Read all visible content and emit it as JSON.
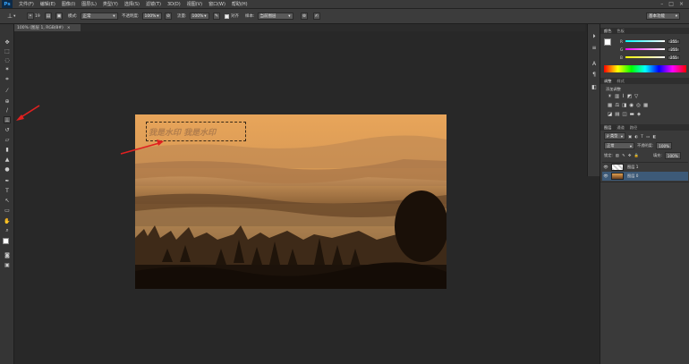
{
  "app": {
    "logo": "Ps"
  },
  "menu": [
    "文件(F)",
    "编辑(E)",
    "图像(I)",
    "图层(L)",
    "类型(Y)",
    "选择(S)",
    "滤镜(T)",
    "3D(D)",
    "视图(V)",
    "窗口(W)",
    "帮助(H)"
  ],
  "options": {
    "brush_size": "19",
    "mode_label": "模式:",
    "mode_value": "正常",
    "opacity_label": "不透明度:",
    "opacity_value": "100%",
    "flow_label": "流量:",
    "flow_value": "100%",
    "aligned_label": "对齐",
    "sample_label": "样本:",
    "sample_value": "当前图层",
    "workspace": "基本功能"
  },
  "document": {
    "tab_title": "100% (图层 1, RGB/8#)",
    "close": "×"
  },
  "watermark": {
    "text": "我是水印 我是水印"
  },
  "color_panel": {
    "tabs": [
      "颜色",
      "色板"
    ],
    "channels": [
      {
        "label": "R",
        "value": "255"
      },
      {
        "label": "G",
        "value": "255"
      },
      {
        "label": "B",
        "value": "255"
      }
    ]
  },
  "adjust_panel": {
    "tabs": [
      "调整",
      "样式"
    ],
    "title": "添加调整"
  },
  "layers_panel": {
    "tabs": [
      "图层",
      "通道",
      "路径"
    ],
    "kind_label": "ρ 类型",
    "blend_mode": "正常",
    "opacity_label": "不透明度:",
    "opacity_value": "100%",
    "lock_label": "锁定:",
    "fill_label": "填充:",
    "fill_value": "100%",
    "layers": [
      {
        "name": "图层 1",
        "selected": false
      },
      {
        "name": "图层 0",
        "selected": true
      }
    ]
  },
  "colors": {
    "accent": "#36a6ff",
    "selected_layer": "#3d5a78"
  }
}
